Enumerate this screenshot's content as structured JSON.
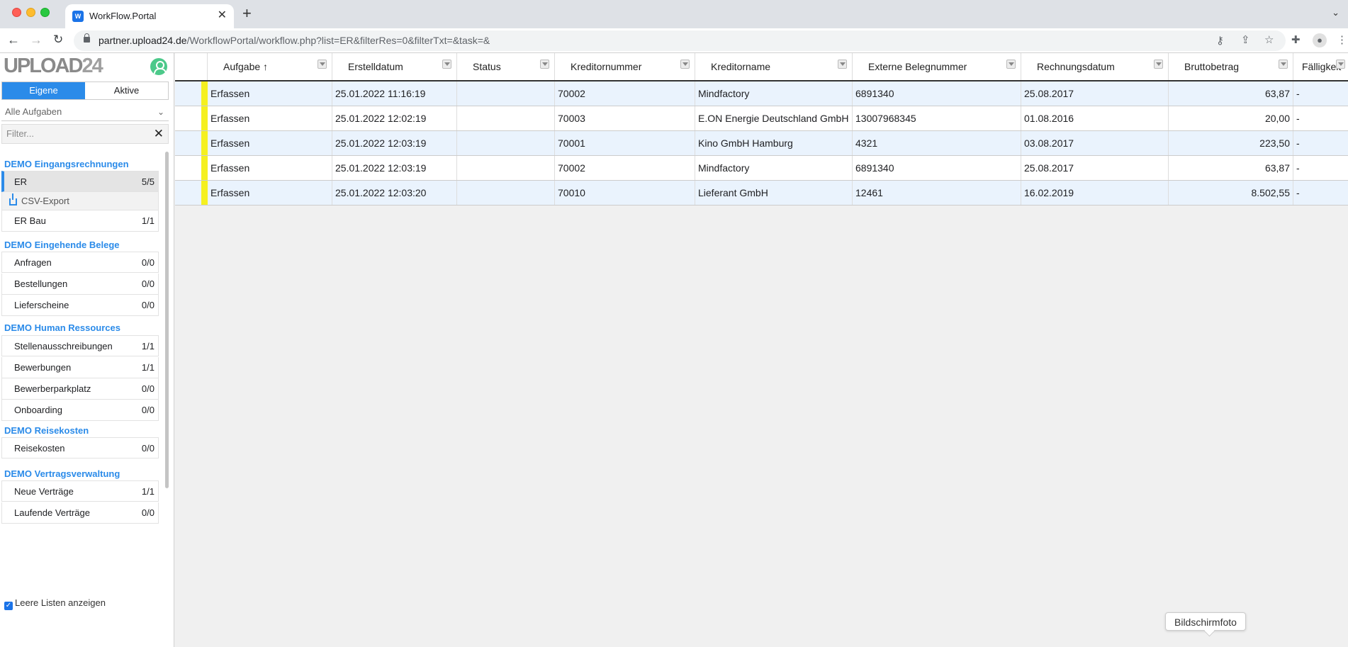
{
  "browser": {
    "tab_title": "WorkFlow.Portal",
    "tab_close": "✕",
    "new_tab": "+",
    "url_host": "partner.upload24.de",
    "url_path": "/WorkflowPortal/workflow.php?list=ER&filterRes=0&filterTxt=&task=&"
  },
  "sidebar": {
    "logo": "UPLOAD",
    "logo_suffix": "24",
    "tabs": {
      "own": "Eigene",
      "active": "Aktive"
    },
    "task_select": "Alle Aufgaben",
    "filter_placeholder": "Filter...",
    "sections": [
      {
        "title": "DEMO Eingangsrechnungen",
        "items": [
          {
            "label": "ER",
            "count": "5/5",
            "selected": true
          },
          {
            "label": "CSV-Export",
            "count": ""
          },
          {
            "label": "ER Bau",
            "count": "1/1"
          }
        ]
      },
      {
        "title": "DEMO Eingehende Belege",
        "items": [
          {
            "label": "Anfragen",
            "count": "0/0"
          },
          {
            "label": "Bestellungen",
            "count": "0/0"
          },
          {
            "label": "Lieferscheine",
            "count": "0/0"
          }
        ]
      },
      {
        "title": "DEMO Human Ressources",
        "items": [
          {
            "label": "Stellenausschreibungen",
            "count": "1/1"
          },
          {
            "label": "Bewerbungen",
            "count": "1/1"
          },
          {
            "label": "Bewerberparkplatz",
            "count": "0/0"
          },
          {
            "label": "Onboarding",
            "count": "0/0"
          }
        ]
      },
      {
        "title": "DEMO Reisekosten",
        "items": [
          {
            "label": "Reisekosten",
            "count": "0/0"
          }
        ]
      },
      {
        "title": "DEMO Vertragsverwaltung",
        "items": [
          {
            "label": "Neue Verträge",
            "count": "1/1"
          },
          {
            "label": "Laufende Verträge",
            "count": "0/0"
          }
        ]
      }
    ],
    "show_empty_lists": "Leere Listen anzeigen"
  },
  "table": {
    "columns": [
      "Aufgabe ↑",
      "Erstelldatum",
      "Status",
      "Kreditornummer",
      "Kreditorname",
      "Externe Belegnummer",
      "Rechnungsdatum",
      "Bruttobetrag",
      "Fälligkeit"
    ],
    "rows": [
      [
        "Erfassen",
        "25.01.2022 11:16:19",
        "",
        "70002",
        "Mindfactory",
        "6891340",
        "25.08.2017",
        "63,87",
        "-"
      ],
      [
        "Erfassen",
        "25.01.2022 12:02:19",
        "",
        "70003",
        "E.ON Energie Deutschland GmbH",
        "13007968345",
        "01.08.2016",
        "20,00",
        "-"
      ],
      [
        "Erfassen",
        "25.01.2022 12:03:19",
        "",
        "70001",
        "Kino GmbH Hamburg",
        "4321",
        "03.08.2017",
        "223,50",
        "-"
      ],
      [
        "Erfassen",
        "25.01.2022 12:03:19",
        "",
        "70002",
        "Mindfactory",
        "6891340",
        "25.08.2017",
        "63,87",
        "-"
      ],
      [
        "Erfassen",
        "25.01.2022 12:03:20",
        "",
        "70010",
        "Lieferant GmbH",
        "12461",
        "16.02.2019",
        "8.502,55",
        "-"
      ]
    ],
    "marker_color": "#f5f020"
  },
  "tooltip": "Bildschirmfoto"
}
